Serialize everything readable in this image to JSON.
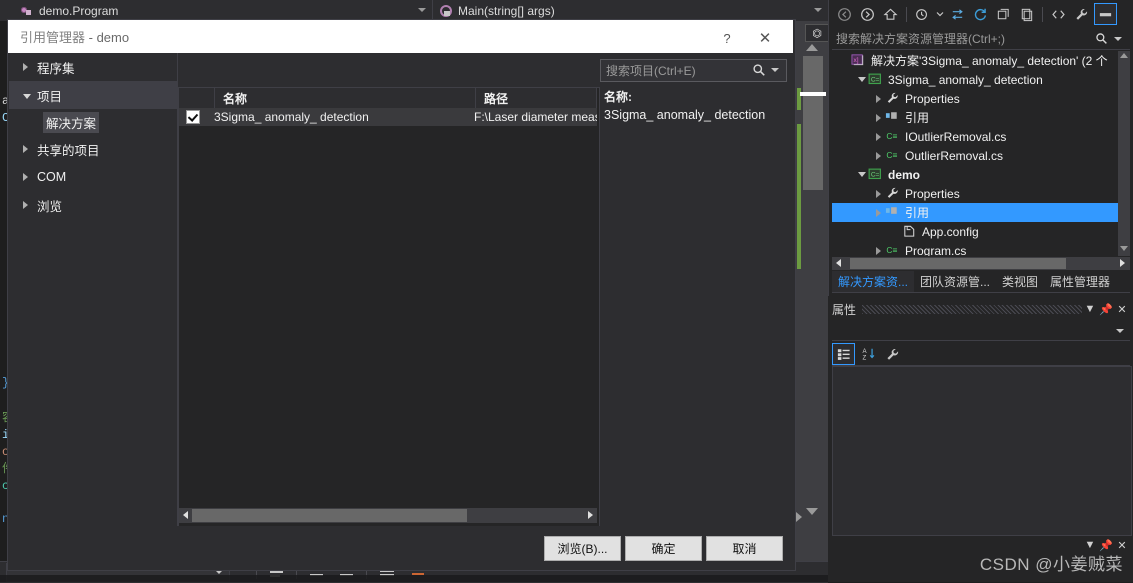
{
  "nav_bar": {
    "left_combo": "demo.Program",
    "right_combo": "Main(string[] args)",
    "class_icon": "class-icon",
    "method_icon": "method-icon"
  },
  "code_editor": {
    "visible_fragments": [
      "as",
      "Ce",
      "} s",
      "容",
      "i]",
      "o]",
      "件",
      "cr",
      "ne"
    ]
  },
  "dialog": {
    "title_main": "引用管理器",
    "title_sep": " - ",
    "title_target": "demo",
    "help_icon": "question-mark-icon",
    "close_icon": "close-icon",
    "categories": [
      {
        "label": "程序集",
        "state": "collapsed",
        "selected": false
      },
      {
        "label": "项目",
        "state": "expanded",
        "selected": true
      },
      {
        "label": "共享的项目",
        "state": "collapsed",
        "selected": false
      },
      {
        "label": "COM",
        "state": "collapsed",
        "selected": false
      },
      {
        "label": "浏览",
        "state": "collapsed",
        "selected": false
      }
    ],
    "sub_item": "解决方案",
    "search": {
      "placeholder": "搜索项目(Ctrl+E)",
      "icon": "search-icon",
      "caret_icon": "chevron-down-icon"
    },
    "list": {
      "columns": [
        "名称",
        "路径"
      ],
      "rows": [
        {
          "checked": true,
          "name": "3Sigma_ anomaly_ detection",
          "path": "F:\\Laser diameter meas"
        }
      ]
    },
    "detail": {
      "label": "名称:",
      "value": "3Sigma_ anomaly_ detection"
    },
    "buttons": {
      "browse": "浏览(B)...",
      "ok": "确定",
      "cancel": "取消"
    }
  },
  "solution_explorer": {
    "toolbar_icons": [
      "back-arrow-icon",
      "forward-arrow-icon",
      "home-icon",
      "pending-changes-icon",
      "sync-with-active-document-icon",
      "refresh-icon",
      "collapse-all-icon",
      "show-all-files-icon",
      "view-code-icon",
      "properties-wrench-icon",
      "preview-selected-items-icon"
    ],
    "search": {
      "placeholder": "搜索解决方案资源管理器(Ctrl+;)",
      "icon": "search-icon",
      "caret_icon": "chevron-down-icon"
    },
    "tree": [
      {
        "label": "解决方案'3Sigma_ anomaly_ detection' (2 个",
        "indent": 0,
        "twisty": "none",
        "icon": "solution-icon",
        "bold": false,
        "selected": false
      },
      {
        "label": "3Sigma_ anomaly_ detection",
        "indent": 1,
        "twisty": "expanded",
        "icon": "csharp-project-icon",
        "bold": false,
        "selected": false
      },
      {
        "label": "Properties",
        "indent": 2,
        "twisty": "collapsed",
        "icon": "wrench-icon",
        "bold": false,
        "selected": false
      },
      {
        "label": "引用",
        "indent": 2,
        "twisty": "collapsed",
        "icon": "references-icon",
        "bold": false,
        "selected": false
      },
      {
        "label": "IOutlierRemoval.cs",
        "indent": 2,
        "twisty": "collapsed",
        "icon": "csharp-file-icon",
        "bold": false,
        "selected": false
      },
      {
        "label": "OutlierRemoval.cs",
        "indent": 2,
        "twisty": "collapsed",
        "icon": "csharp-file-icon",
        "bold": false,
        "selected": false
      },
      {
        "label": "demo",
        "indent": 1,
        "twisty": "expanded",
        "icon": "csharp-project-icon",
        "bold": true,
        "selected": false
      },
      {
        "label": "Properties",
        "indent": 2,
        "twisty": "collapsed",
        "icon": "wrench-icon",
        "bold": false,
        "selected": false
      },
      {
        "label": "引用",
        "indent": 2,
        "twisty": "collapsed",
        "icon": "references-icon",
        "bold": false,
        "selected": true
      },
      {
        "label": "App.config",
        "indent": 3,
        "twisty": "none",
        "icon": "config-file-icon",
        "bold": false,
        "selected": false
      },
      {
        "label": "Program.cs",
        "indent": 2,
        "twisty": "collapsed",
        "icon": "csharp-file-icon",
        "bold": false,
        "selected": false
      }
    ],
    "tabs": [
      {
        "label": "解决方案资...",
        "active": true
      },
      {
        "label": "团队资源管...",
        "active": false
      },
      {
        "label": "类视图",
        "active": false
      },
      {
        "label": "属性管理器",
        "active": false
      }
    ]
  },
  "properties_panel": {
    "title": "属性",
    "dropdown_caret": "chevron-down-icon",
    "pin_icon": "pin-icon",
    "close_icon": "close-icon",
    "toolbar_icons": [
      "categorized-icon",
      "alphabetical-sort-icon",
      "property-pages-wrench-icon"
    ],
    "footer_caret": "chevron-down-icon"
  },
  "watermark": "CSDN @小姜贼菜",
  "colors": {
    "accent_blue": "#3399ff",
    "editor_bg": "#1e1e1e",
    "chrome_bg": "#2d2d30",
    "panel_bg": "#252526",
    "dialog_titlebar": "#ffffff",
    "change_marker_green": "#6c9b41"
  }
}
